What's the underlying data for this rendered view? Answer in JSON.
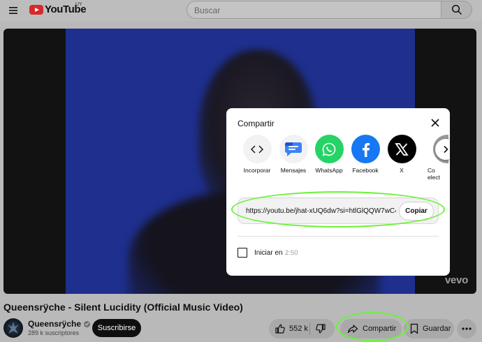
{
  "header": {
    "logo_text": "YouTube",
    "country_code": "UY",
    "search_placeholder": "Buscar",
    "menu_icon": "hamburger-menu-icon",
    "search_icon": "search-icon"
  },
  "video": {
    "watermark": "vevo",
    "title": "Queensrÿche - Silent Lucidity (Official Music Video)"
  },
  "channel": {
    "name": "Queensrÿche",
    "subscribers": "289 k suscriptores",
    "subscribe_label": "Suscribirse",
    "verified_icon": "verified-badge-icon"
  },
  "actions": {
    "like_count": "552 k",
    "share_label": "Compartir",
    "save_label": "Guardar"
  },
  "share_dialog": {
    "title": "Compartir",
    "targets": [
      {
        "label": "Incorporar",
        "icon": "embed-code-icon",
        "bg": "#f2f2f2"
      },
      {
        "label": "Mensajes",
        "icon": "google-messages-icon",
        "bg": "#f2f2f2"
      },
      {
        "label": "WhatsApp",
        "icon": "whatsapp-icon",
        "bg": "#25d366"
      },
      {
        "label": "Facebook",
        "icon": "facebook-icon",
        "bg": "#1877f2"
      },
      {
        "label": "X",
        "icon": "x-logo-icon",
        "bg": "#000000"
      },
      {
        "label": "Co\nelect",
        "icon": "email-icon",
        "bg": "#909090"
      }
    ],
    "url": "https://youtu.be/jhat-xUQ6dw?si=htlGlQQW7wC‹",
    "copy_label": "Copiar",
    "start_label": "Iniciar en",
    "start_time": "2:50",
    "start_checked": false
  },
  "colors": {
    "highlight": "#6af23a",
    "youtube_red": "#ff0000",
    "video_bg": "#1e2f8e"
  }
}
